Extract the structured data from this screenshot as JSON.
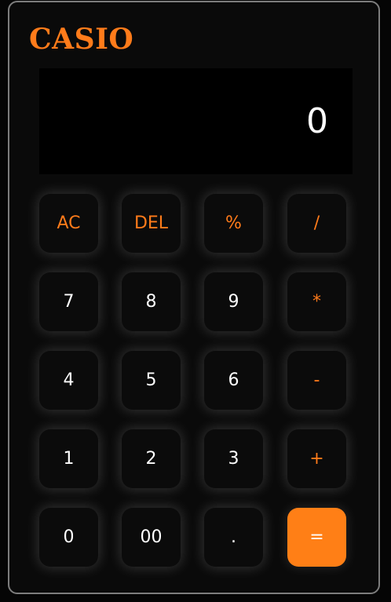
{
  "app": {
    "brand": "CASIO"
  },
  "display": {
    "value": "0"
  },
  "keypad": {
    "keys": [
      "AC",
      "DEL",
      "%",
      "/",
      "7",
      "8",
      "9",
      "*",
      "4",
      "5",
      "6",
      "-",
      "1",
      "2",
      "3",
      "+",
      "0",
      "00",
      ".",
      "="
    ]
  },
  "colors": {
    "accent": "#ff7b1a",
    "equals_bg": "#ff7f16",
    "display_bg": "#000000",
    "body_bg": "#0a0a0a",
    "frame_border": "#7d7d7d"
  }
}
